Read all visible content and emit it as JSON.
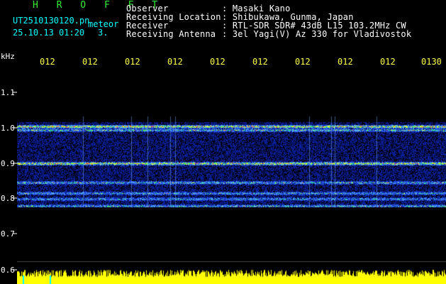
{
  "header": {
    "program": "H R O F F T",
    "filename": "UT2510130120.pn",
    "tag": "meteor",
    "datetime": "25.10.13 01:20",
    "speed": "3.",
    "fields": [
      {
        "label": "Observer",
        "value": ": Masaki Kano"
      },
      {
        "label": "Receiving Location",
        "value": ": Shibukawa, Gunma, Japan"
      },
      {
        "label": "Receiver",
        "value": ": RTL-SDR SDR# 43dB L15 103.2MHz CW"
      },
      {
        "label": "Receiving Antenna",
        "value": ": 3el Yagi(V) Az 330 for Vladivostok"
      }
    ]
  },
  "yaxis": {
    "unit": "kHz",
    "ticks": [
      "1.1",
      "1.0",
      "0.9",
      "0.8",
      "0.7",
      "0.6"
    ]
  },
  "xaxis": {
    "ticks": [
      "012",
      "012",
      "012",
      "012",
      "012",
      "012",
      "012",
      "012",
      "012",
      "0130"
    ]
  },
  "colors": {
    "background": "#000000",
    "spectrum_low": "#0a1a8c",
    "spectrum_mid": "#2a6cff",
    "spectrum_high": "#00ff66",
    "spectrum_peak": "#ff3030",
    "signal_bar": "#ffff00",
    "text": "#ffffff",
    "title": "#33ee33",
    "ticks": "#ffff44"
  }
}
